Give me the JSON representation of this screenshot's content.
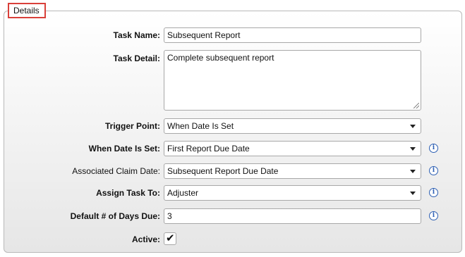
{
  "section": {
    "title": "Details"
  },
  "task_name": {
    "label": "Task Name:",
    "value": "Subsequent Report"
  },
  "task_detail": {
    "label": "Task Detail:",
    "value": "Complete subsequent report"
  },
  "trigger_point": {
    "label": "Trigger Point:",
    "value": "When Date Is Set"
  },
  "when_date_is_set": {
    "label": "When Date Is Set:",
    "value": "First Report Due Date",
    "info_icon": "info-icon"
  },
  "associated_claim_date": {
    "label": "Associated Claim Date:",
    "value": "Subsequent Report Due Date",
    "info_icon": "info-icon"
  },
  "assign_task_to": {
    "label": "Assign Task To:",
    "value": "Adjuster",
    "info_icon": "info-icon"
  },
  "default_days_due": {
    "label": "Default # of Days Due:",
    "value": "3",
    "info_icon": "info-icon"
  },
  "active": {
    "label": "Active:",
    "checked": true,
    "check_glyph": "✔"
  },
  "info_glyph": "i",
  "colors": {
    "legend_border": "#d9403a",
    "info_icon": "#2d5fb3"
  }
}
